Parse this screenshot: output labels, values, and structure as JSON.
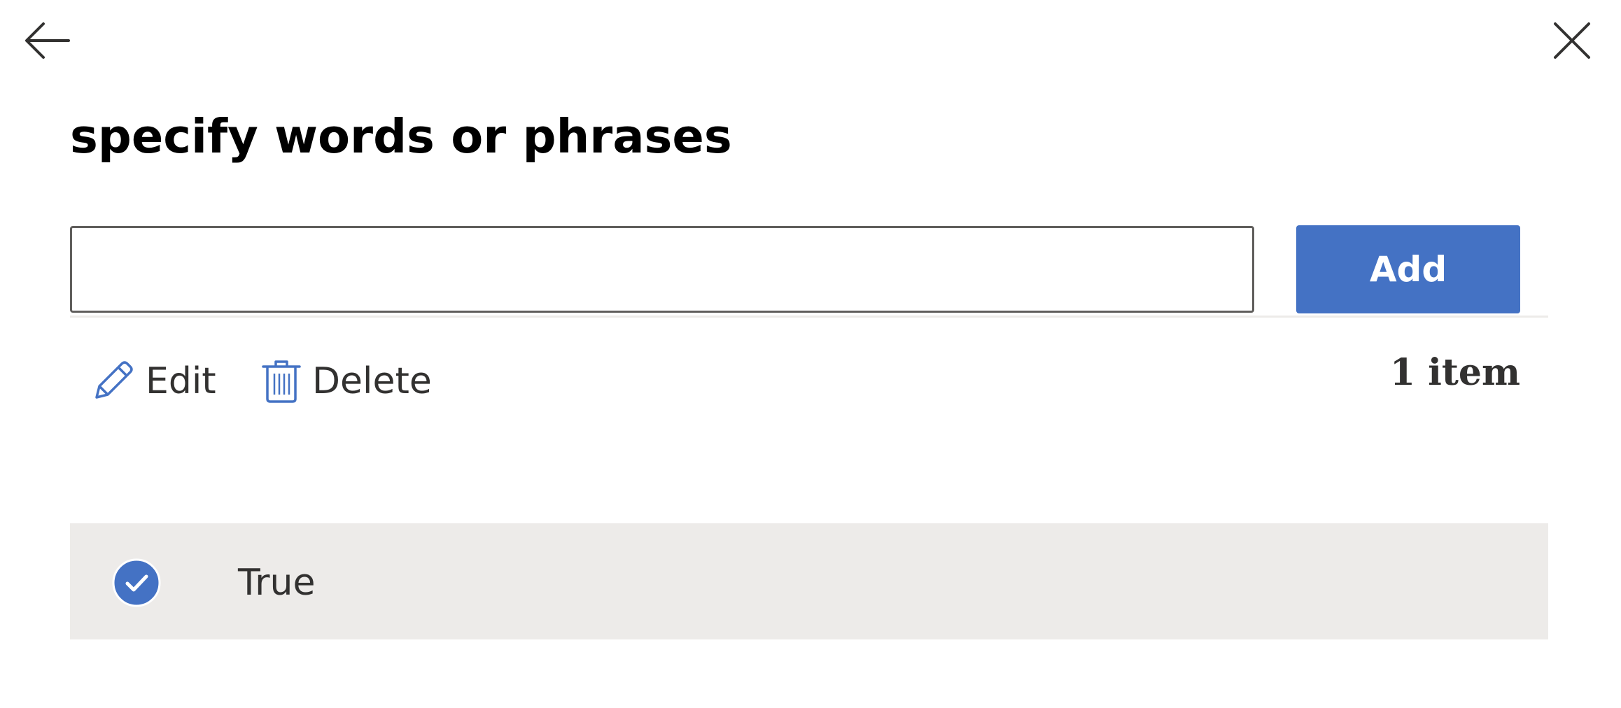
{
  "header": {
    "back_icon": "arrow-left-icon",
    "close_icon": "close-icon"
  },
  "panel": {
    "title": "specify words or phrases"
  },
  "input": {
    "value": "",
    "placeholder": ""
  },
  "add_button": {
    "label": "Add"
  },
  "commands": {
    "edit": {
      "label": "Edit",
      "icon": "pencil-icon"
    },
    "delete": {
      "label": "Delete",
      "icon": "trash-icon"
    }
  },
  "list": {
    "count_label": "1 item",
    "items": [
      {
        "text": "True",
        "selected": true,
        "icon": "checkmark-circle-icon"
      }
    ]
  },
  "colors": {
    "accent": "#4472c4",
    "row_selected_bg": "#edebe9",
    "text_primary": "#323130"
  }
}
